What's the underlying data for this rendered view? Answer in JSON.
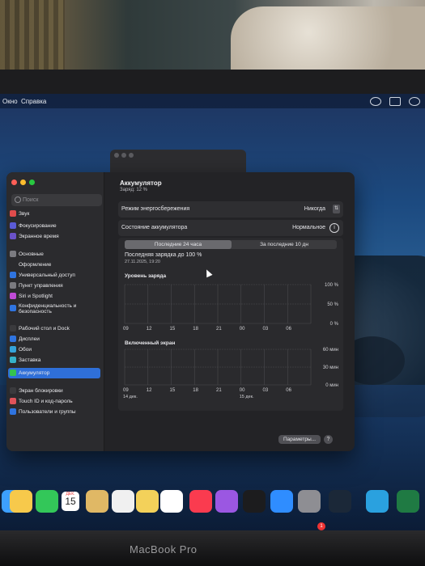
{
  "menubar": {
    "item1": "Окно",
    "item2": "Справка"
  },
  "sidebar": {
    "search_placeholder": "Поиск",
    "items": [
      {
        "label": "Звук",
        "color": "#e04c4c"
      },
      {
        "label": "Фокусирование",
        "color": "#5b5bd6"
      },
      {
        "label": "Экранное время",
        "color": "#6a52c9"
      },
      {
        "label": "Основные",
        "color": "#7b7b80"
      },
      {
        "label": "Оформление",
        "color": "#2b2b2e"
      },
      {
        "label": "Универсальный доступ",
        "color": "#2f74e0"
      },
      {
        "label": "Пункт управления",
        "color": "#7b7b80"
      },
      {
        "label": "Siri и Spotlight",
        "color": "#c04bd6"
      },
      {
        "label": "Конфиденциальность и безопасность",
        "color": "#2f74e0"
      },
      {
        "label": "Рабочий стол и Dock",
        "color": "#3a3a3d"
      },
      {
        "label": "Дисплеи",
        "color": "#2f74e0"
      },
      {
        "label": "Обои",
        "color": "#35a3d9"
      },
      {
        "label": "Заставка",
        "color": "#36b2c9"
      },
      {
        "label": "Аккумулятор",
        "color": "#35c24e"
      },
      {
        "label": "Экран блокировки",
        "color": "#3a3a3d"
      },
      {
        "label": "Touch ID и код-пароль",
        "color": "#e0535a"
      },
      {
        "label": "Пользователи и группы",
        "color": "#2f74e0"
      }
    ]
  },
  "battery": {
    "title": "Аккумулятор",
    "subtitle": "Заряд: 12 %",
    "power_mode_label": "Режим энергосбережения",
    "power_mode_value": "Никогда",
    "health_label": "Состояние аккумулятора",
    "health_value": "Нормальное",
    "tab_24h": "Последние 24 часа",
    "tab_10d": "За последние 10 дн",
    "last_charge_label": "Последняя зарядка до 100 %",
    "last_charge_time": "27.11.2025, 19:20",
    "charge_level_title": "Уровень заряда",
    "screen_on_title": "Включенный экран",
    "settings_button": "Параметры...",
    "help": "?"
  },
  "chart_data": [
    {
      "type": "bar",
      "title": "Уровень заряда",
      "categories": [
        "09",
        "12",
        "15",
        "18",
        "21",
        "00",
        "03",
        "06"
      ],
      "values": [],
      "y_ticks": [
        "100 %",
        "50 %",
        "0 %"
      ],
      "grid": true
    },
    {
      "type": "bar",
      "title": "Включенный экран",
      "categories": [
        "09",
        "12",
        "15",
        "18",
        "21",
        "00",
        "03",
        "06"
      ],
      "values": [],
      "y_ticks": [
        "60 мин",
        "30 мин",
        "0 мин"
      ],
      "date_labels": [
        "14 дек.",
        "15 дек."
      ],
      "grid": true
    }
  ],
  "dock": {
    "calendar_month": "ДЕК.",
    "calendar_day": "15",
    "app_store_badge": "1",
    "icons": [
      "finder-icon",
      "photos-icon",
      "facetime-icon",
      "calendar-icon",
      "notes-icon",
      "reminders-icon",
      "stickies-icon",
      "freeform-icon",
      "music-icon",
      "podcasts-icon",
      "tv-icon",
      "app-store-icon",
      "system-settings-icon",
      "steam-icon",
      "telegram-icon",
      "excel-icon"
    ],
    "colors": [
      "#3da0ff",
      "#f7c94b",
      "#33c759",
      "#ffffff",
      "#e0b865",
      "#f0f0f0",
      "#f3d15a",
      "#ffffff",
      "#fa3b4f",
      "#9b57e2",
      "#1c1c1e",
      "#2f8dff",
      "#8e8e93",
      "#1b2838",
      "#2aa1df",
      "#1f7a43"
    ]
  },
  "laptop": {
    "brand": "MacBook Pro"
  }
}
